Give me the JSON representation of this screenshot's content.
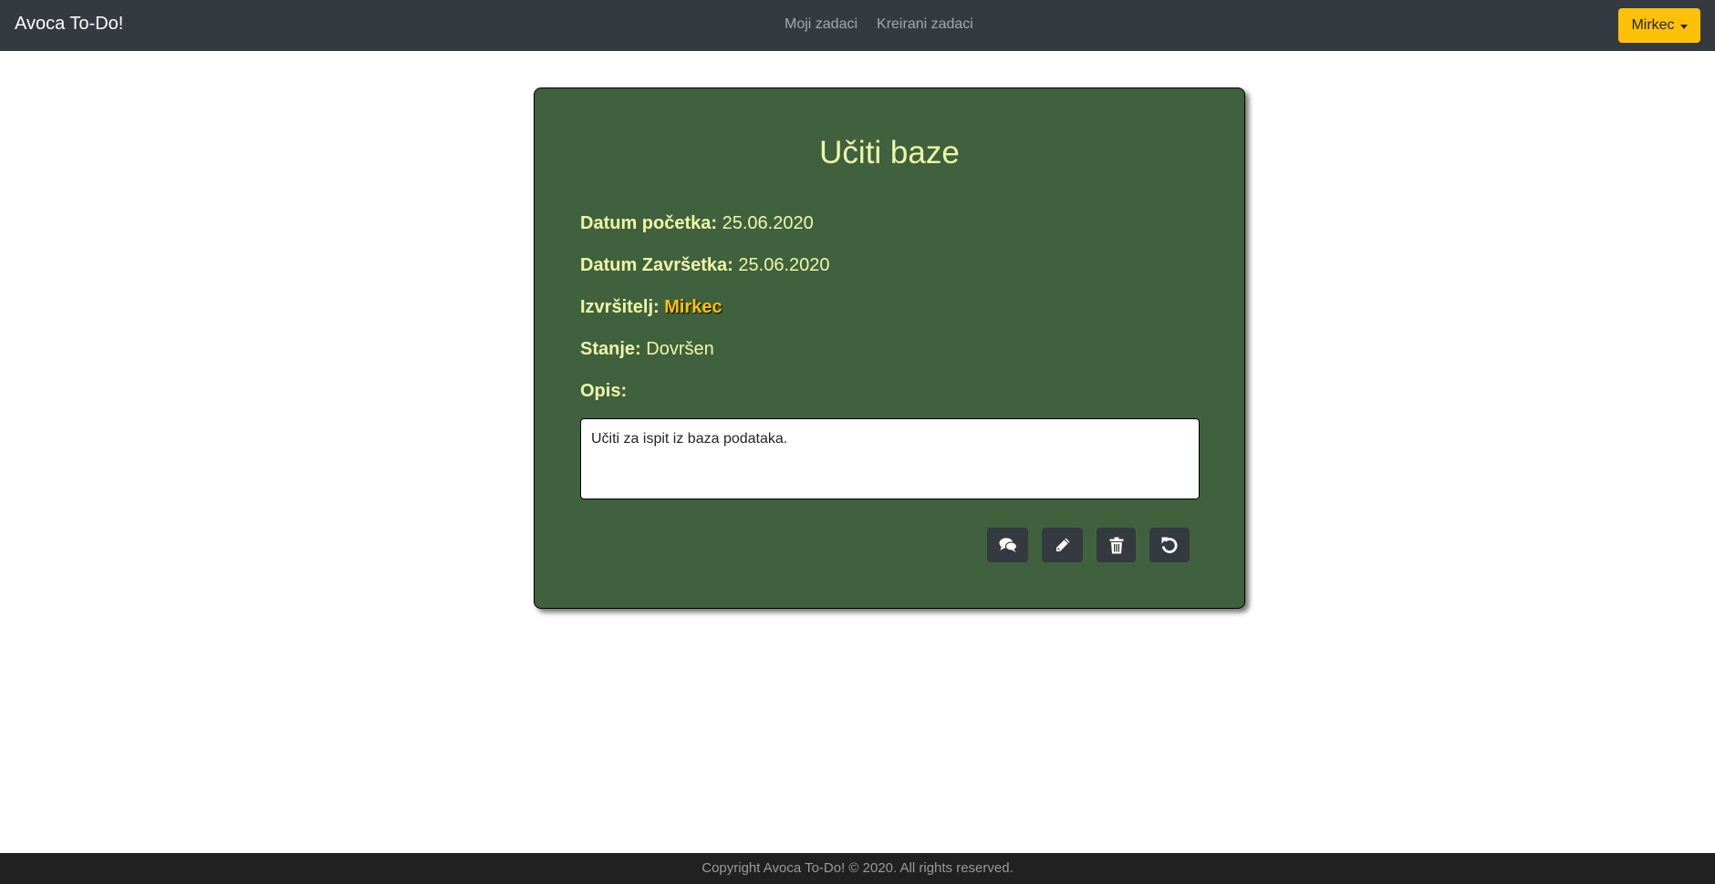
{
  "navbar": {
    "brand": "Avoca To-Do!",
    "links": [
      "Moji zadaci",
      "Kreirani zadaci"
    ],
    "user": "Mirkec"
  },
  "task": {
    "title": "Učiti baze",
    "start_label": "Datum početka:",
    "start_value": "25.06.2020",
    "end_label": "Datum Završetka:",
    "end_value": "25.06.2020",
    "assignee_label": "Izvršitelj:",
    "assignee_value": "Mirkec",
    "status_label": "Stanje:",
    "status_value": "Dovršen",
    "description_label": "Opis:",
    "description": "Učiti za ispit iz baza podataka."
  },
  "actions": {
    "icons": [
      "comments-icon",
      "pencil-icon",
      "trash-icon",
      "undo-icon"
    ]
  },
  "footer": {
    "text": "Copyright Avoca To-Do! © 2020. All rights reserved."
  },
  "colors": {
    "navbar": "#343a40",
    "card": "#40613d",
    "label": "#eef7a8",
    "accent": "#ffc107",
    "footer": "#212121"
  }
}
